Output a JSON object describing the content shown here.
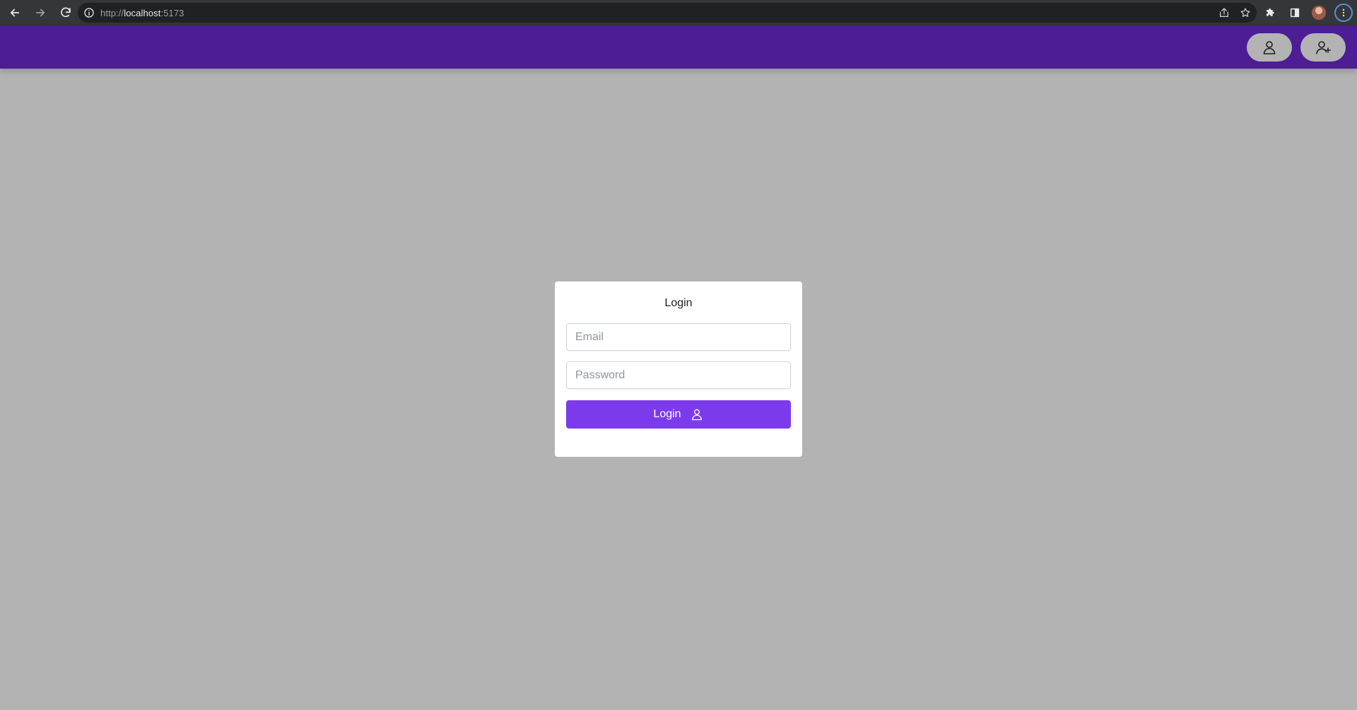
{
  "browser": {
    "url_scheme": "http://",
    "url_host": "localhost",
    "url_port": ":5173",
    "icons": {
      "back": "arrow-left-icon",
      "forward": "arrow-right-icon",
      "reload": "reload-icon",
      "site_info": "info-icon",
      "share": "share-icon",
      "bookmark": "star-icon",
      "extensions": "puzzle-icon",
      "side_panel": "side-panel-icon",
      "profile": "avatar",
      "menu": "kebab-menu-icon"
    }
  },
  "header": {
    "background_color": "#4c1d95",
    "login_icon": "user-icon",
    "register_icon": "user-plus-icon"
  },
  "login_form": {
    "title": "Login",
    "email_placeholder": "Email",
    "password_placeholder": "Password",
    "submit_label": "Login",
    "submit_icon": "user-icon",
    "accent_color": "#7c3aed"
  },
  "page": {
    "background_color": "#b3b3b3"
  }
}
